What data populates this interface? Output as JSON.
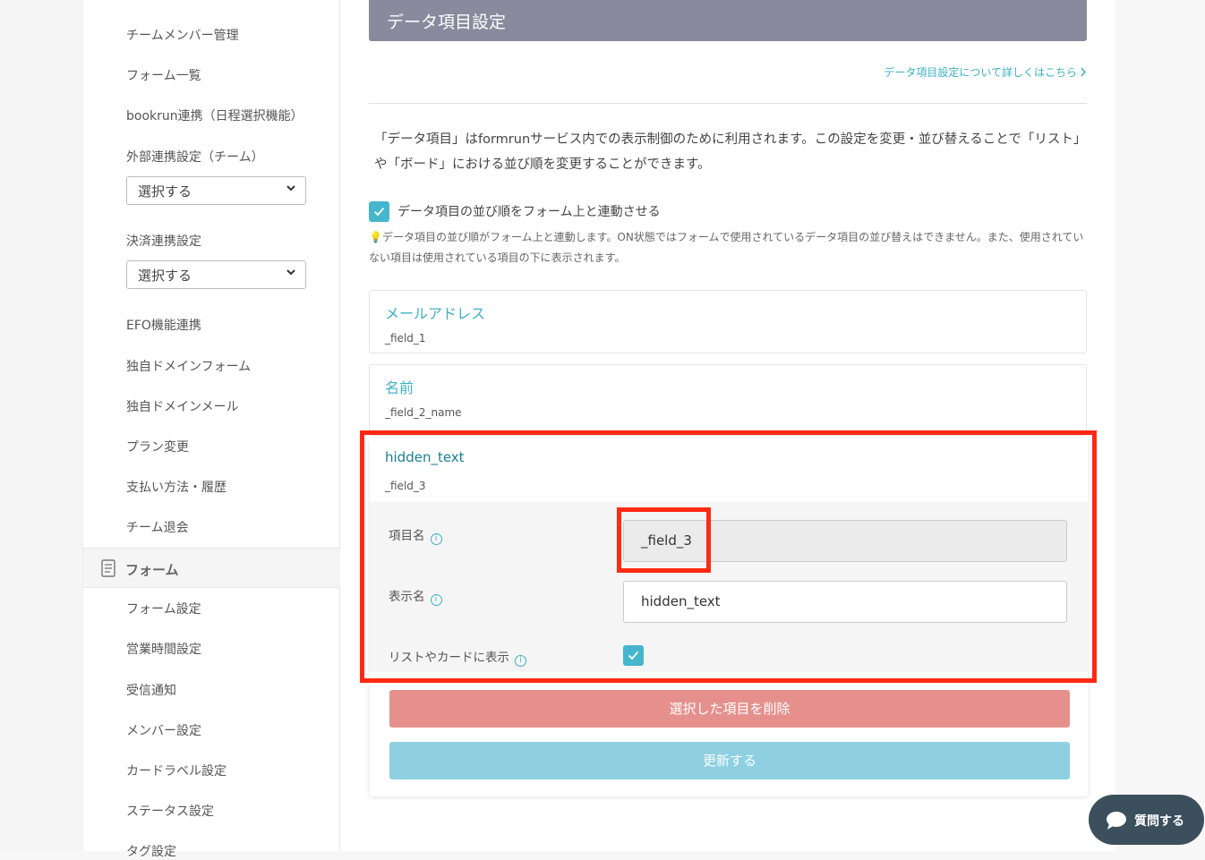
{
  "sidebar": {
    "team_items": [
      "チームメンバー管理",
      "フォーム一覧",
      "bookrun連携（日程選択機能）",
      "外部連携設定（チーム）"
    ],
    "external_select": "選択する",
    "payment_label": "決済連携設定",
    "payment_select": "選択する",
    "more_items": [
      "EFO機能連携",
      "独自ドメインフォーム",
      "独自ドメインメール",
      "プラン変更",
      "支払い方法・履歴",
      "チーム退会"
    ],
    "form_section_label": "フォーム",
    "form_items": [
      "フォーム設定",
      "営業時間設定",
      "受信通知",
      "メンバー設定",
      "カードラベル設定",
      "ステータス設定",
      "タグ設定"
    ]
  },
  "main": {
    "header_title": "データ項目設定",
    "help_link": "データ項目設定について詳しくはこちら",
    "description": "「データ項目」はformrunサービス内での表示制御のために利用されます。この設定を変更・並び替えることで「リスト」や「ボード」における並び順を変更することができます。",
    "sync_checkbox_label": "データ項目の並び順をフォーム上と連動させる",
    "sync_checked": true,
    "sync_note_icon": "💡",
    "sync_note": "データ項目の並び順がフォーム上と連動します。ON状態ではフォームで使用されているデータ項目の並び替えはできません。また、使用されていない項目は使用されている項目の下に表示されます。",
    "fields": [
      {
        "title": "メールアドレス",
        "key": "_field_1"
      },
      {
        "title": "名前",
        "key": "_field_2_name"
      },
      {
        "title": "hidden_text",
        "key": "_field_3"
      }
    ],
    "detail": {
      "item_name_label": "項目名",
      "item_name_value": "_field_3",
      "display_name_label": "表示名",
      "display_name_value": "hidden_text",
      "show_in_list_label": "リストやカードに表示",
      "show_in_list_checked": true,
      "info_glyph": "i"
    },
    "delete_button": "選択した項目を削除",
    "update_button": "更新する"
  },
  "chat_button": "質問する",
  "colors": {
    "accent": "#3fb0c6",
    "header": "#8a8a9e",
    "highlight": "#ff2a12",
    "delete": "#e6908e",
    "update": "#8ed0e2"
  }
}
